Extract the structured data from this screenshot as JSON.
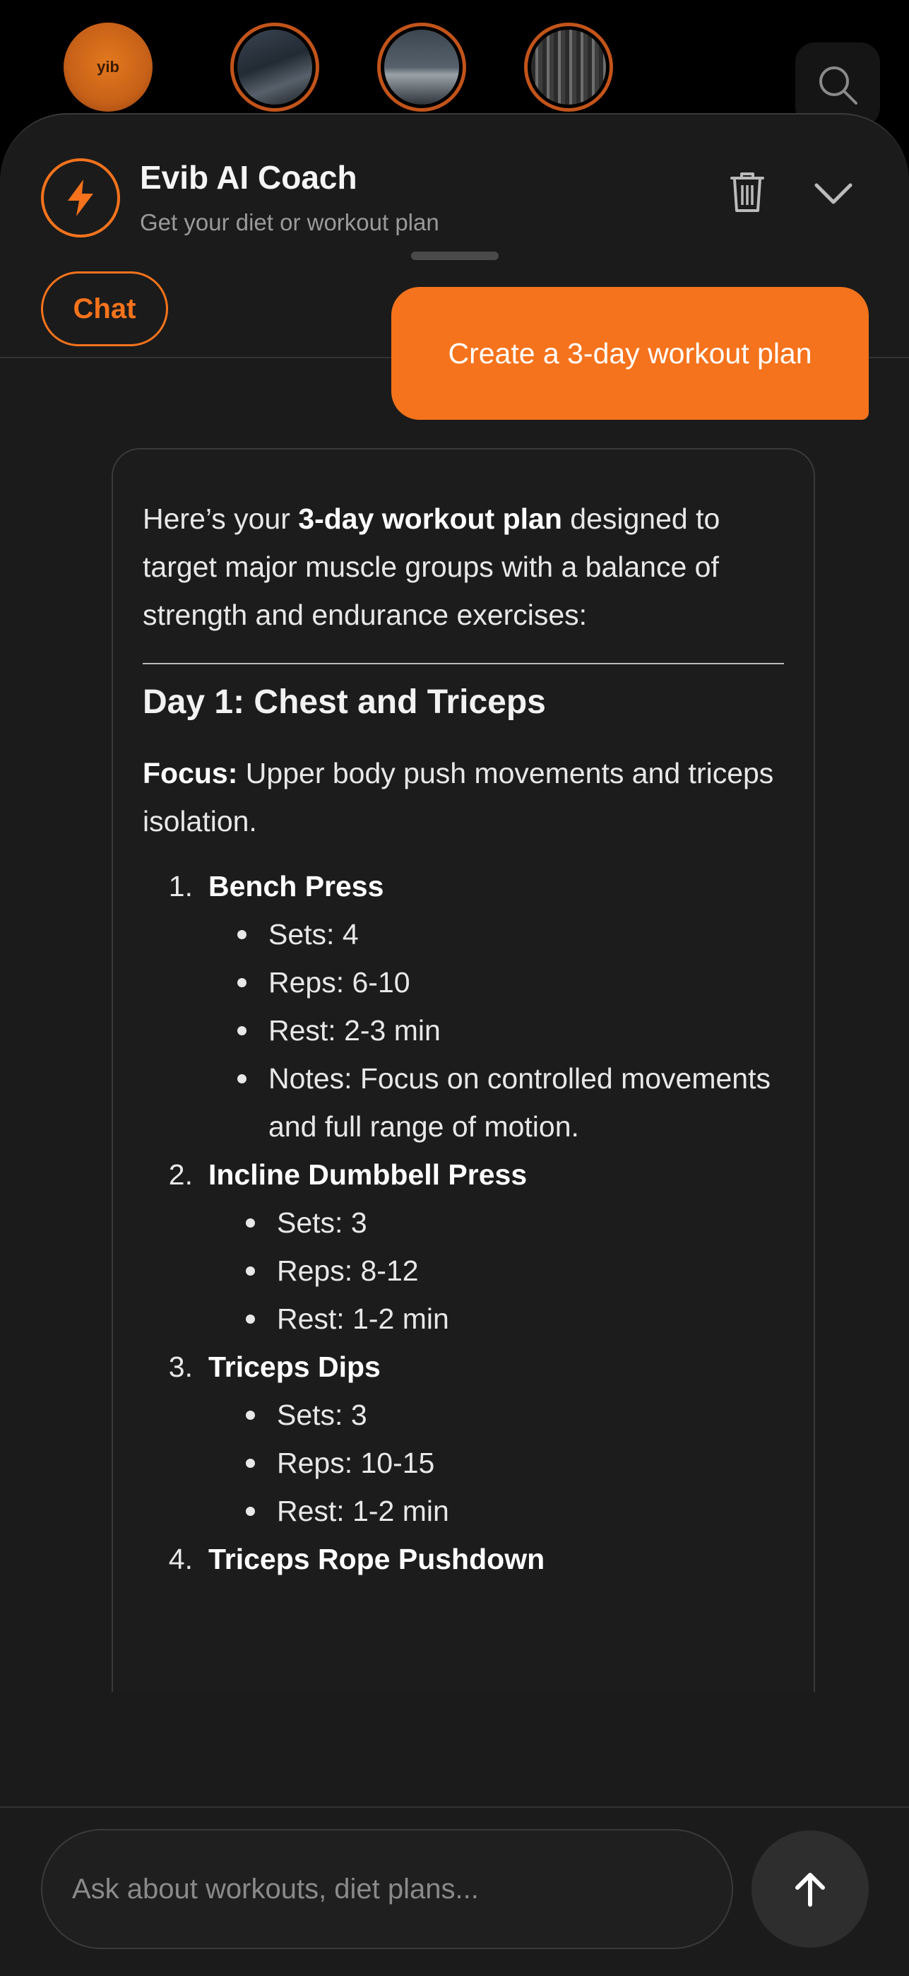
{
  "stories": [
    {
      "name": "story-evib-logo",
      "logo_text": "yib"
    },
    {
      "name": "story-street"
    },
    {
      "name": "story-landscape"
    },
    {
      "name": "story-building"
    }
  ],
  "header": {
    "title": "Evib AI Coach",
    "subtitle": "Get your diet or workout plan",
    "tab_chat": "Chat",
    "icons": {
      "coach": "lightning-bolt-icon",
      "trash": "trash-icon",
      "collapse": "chevron-down-icon",
      "search": "search-icon"
    }
  },
  "accent_color": "#f5731c",
  "user_message": "Create a 3-day workout plan",
  "ai_message": {
    "intro_pre": "Here’s your ",
    "intro_bold": "3-day workout plan",
    "intro_post": " designed to target major muscle groups with a balance of strength and endurance exercises:",
    "day_title": "Day 1: Chest and Triceps",
    "focus_label": "Focus:",
    "focus_text": " Upper body push movements and triceps isolation.",
    "exercises": [
      {
        "num": "1.",
        "name": "Bench Press",
        "details": [
          "Sets: 4",
          "Reps: 6-10",
          "Rest: 2-3 min",
          "Notes: Focus on controlled movements and full range of motion."
        ]
      },
      {
        "num": "2.",
        "name": "Incline Dumbbell Press",
        "details": [
          "Sets: 3",
          "Reps: 8-12",
          "Rest: 1-2 min"
        ]
      },
      {
        "num": "3.",
        "name": "Triceps Dips",
        "details": [
          "Sets: 3",
          "Reps: 10-15",
          "Rest: 1-2 min"
        ]
      },
      {
        "num": "4.",
        "name": "Triceps Rope Pushdown",
        "details": []
      }
    ]
  },
  "composer": {
    "placeholder": "Ask about workouts, diet plans...",
    "send_icon": "arrow-up-icon"
  }
}
